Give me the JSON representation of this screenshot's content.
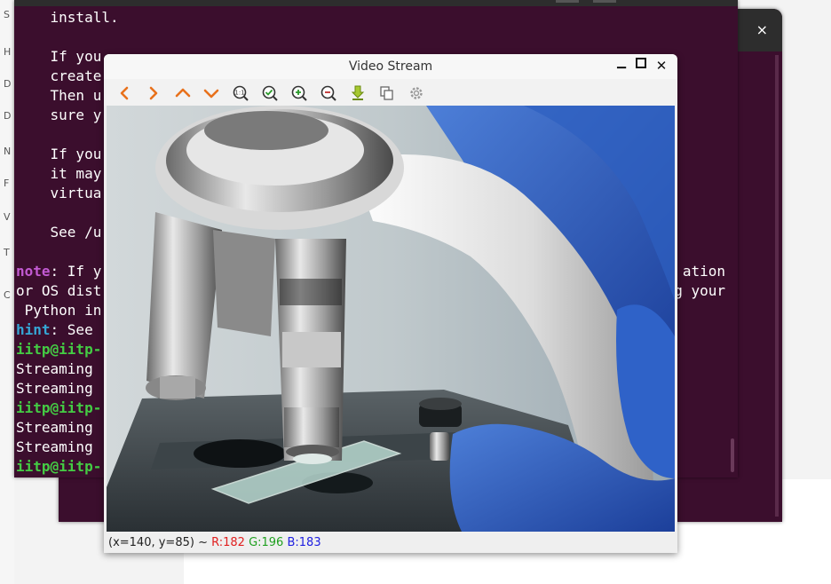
{
  "desktop": {
    "left_strip_letters": [
      "S",
      "H",
      "D",
      "D",
      "N",
      "F",
      "V",
      "T",
      "C"
    ]
  },
  "terminal": {
    "lines": [
      {
        "parts": [
          {
            "t": "    install.",
            "c": ""
          }
        ]
      },
      {
        "parts": [
          {
            "t": "",
            "c": ""
          }
        ]
      },
      {
        "parts": [
          {
            "t": "    If you",
            "c": ""
          }
        ]
      },
      {
        "parts": [
          {
            "t": "    create",
            "c": ""
          }
        ]
      },
      {
        "parts": [
          {
            "t": "    Then u",
            "c": ""
          }
        ]
      },
      {
        "parts": [
          {
            "t": "    sure y",
            "c": ""
          }
        ]
      },
      {
        "parts": [
          {
            "t": "",
            "c": ""
          }
        ]
      },
      {
        "parts": [
          {
            "t": "    If you",
            "c": ""
          }
        ]
      },
      {
        "parts": [
          {
            "t": "    it may",
            "c": ""
          }
        ]
      },
      {
        "parts": [
          {
            "t": "    virtua",
            "c": ""
          }
        ]
      },
      {
        "parts": [
          {
            "t": "",
            "c": ""
          }
        ]
      },
      {
        "parts": [
          {
            "t": "    See /u",
            "c": ""
          }
        ]
      },
      {
        "parts": [
          {
            "t": "",
            "c": ""
          }
        ]
      },
      {
        "parts": [
          {
            "t": "note",
            "c": "note-kw"
          },
          {
            "t": ": If y",
            "c": ""
          }
        ]
      },
      {
        "parts": [
          {
            "t": "or OS dist",
            "c": ""
          }
        ]
      },
      {
        "parts": [
          {
            "t": " Python in",
            "c": ""
          }
        ]
      },
      {
        "parts": [
          {
            "t": "hint",
            "c": "hint-kw"
          },
          {
            "t": ": See",
            "c": ""
          }
        ]
      },
      {
        "parts": [
          {
            "t": "iitp@iitp-",
            "c": "prompt"
          }
        ]
      },
      {
        "parts": [
          {
            "t": "Streaming",
            "c": ""
          }
        ]
      },
      {
        "parts": [
          {
            "t": "Streaming",
            "c": ""
          }
        ]
      },
      {
        "parts": [
          {
            "t": "iitp@iitp-",
            "c": "prompt"
          }
        ]
      },
      {
        "parts": [
          {
            "t": "Streaming",
            "c": ""
          }
        ]
      },
      {
        "parts": [
          {
            "t": "Streaming",
            "c": ""
          }
        ]
      },
      {
        "parts": [
          {
            "t": "iitp@iitp-",
            "c": "prompt"
          }
        ]
      }
    ],
    "right_fragments": [
      {
        "line": 13,
        "text": "ation"
      },
      {
        "line": 14,
        "text": "g your"
      }
    ]
  },
  "back_window": {
    "close_icon": "×"
  },
  "video_window": {
    "title": "Video Stream",
    "minimize": "▁",
    "maximize": "■",
    "close": "✕",
    "toolbar": [
      {
        "name": "pan-left-icon"
      },
      {
        "name": "pan-right-icon"
      },
      {
        "name": "pan-up-icon"
      },
      {
        "name": "pan-down-icon"
      },
      {
        "name": "zoom-original-icon"
      },
      {
        "name": "zoom-fit-icon"
      },
      {
        "name": "zoom-in-icon"
      },
      {
        "name": "zoom-out-icon"
      },
      {
        "name": "save-image-icon"
      },
      {
        "name": "copy-image-icon"
      },
      {
        "name": "properties-icon"
      }
    ],
    "status": {
      "coords": "(x=140, y=85) ~ ",
      "r": "R:182",
      "g": "G:196",
      "b": "B:183",
      "r_color": "#e02020",
      "g_color": "#20a020",
      "b_color": "#2020e0"
    }
  }
}
